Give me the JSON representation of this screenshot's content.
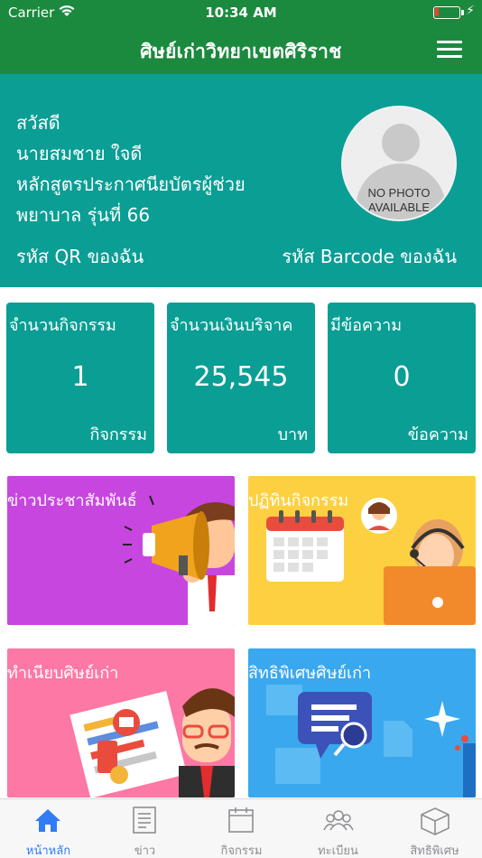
{
  "status_bar": {
    "carrier": "Carrier",
    "time": "10:34 AM"
  },
  "nav": {
    "title": "ศิษย์เก่าวิทยาเขตศิริราช",
    "menu_icon": "hamburger-menu-icon"
  },
  "profile": {
    "greeting": "สวัสดี",
    "name": "นายสมชาย ใจดี",
    "program_line1": "หลักสูตรประกาศนียบัตรผู้ช่วย",
    "program_line2": "พยาบาล รุ่นที่ 66",
    "qr_link": "รหัส QR ของฉัน",
    "barcode_link": "รหัส Barcode ของฉัน",
    "photo_placeholder_line1": "NO PHOTO",
    "photo_placeholder_line2": "AVAILABLE"
  },
  "stats": [
    {
      "label": "จำนวนกิจกรรม",
      "value": "1",
      "unit": "กิจกรรม"
    },
    {
      "label": "จำนวนเงินบริจาค",
      "value": "25,545",
      "unit": "บาท"
    },
    {
      "label": "มีข้อความ",
      "value": "0",
      "unit": "ข้อความ"
    }
  ],
  "tiles": [
    {
      "label": "ข่าวประชาสัมพันธ์",
      "color": "#c846e0"
    },
    {
      "label": "ปฏิทินกิจกรรม",
      "color": "#fcd040"
    },
    {
      "label": "ทำเนียบศิษย์เก่า",
      "color": "#fd78a4"
    },
    {
      "label": "สิทธิพิเศษศิษย์เก่า",
      "color": "#39a8ee"
    }
  ],
  "tabs": [
    {
      "label": "หน้าหลัก",
      "icon": "home-icon",
      "active": true
    },
    {
      "label": "ข่าว",
      "icon": "news-icon"
    },
    {
      "label": "กิจกรรม",
      "icon": "calendar-icon"
    },
    {
      "label": "ทะเบียน",
      "icon": "people-icon"
    },
    {
      "label": "สิทธิพิเศษ",
      "icon": "box-icon"
    }
  ],
  "colors": {
    "nav": "#1b8a3e",
    "teal": "#0a9e94",
    "tab_active": "#2f7cf6"
  }
}
